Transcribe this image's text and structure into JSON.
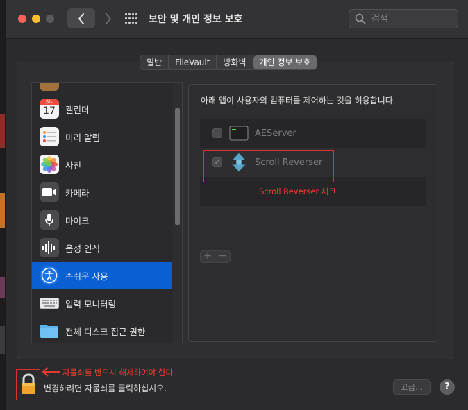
{
  "window": {
    "title": "보안 및 개인 정보 보호",
    "search_placeholder": "검색"
  },
  "tabs": [
    {
      "label": "일반",
      "active": false
    },
    {
      "label": "FileVault",
      "active": false
    },
    {
      "label": "방화벽",
      "active": false
    },
    {
      "label": "개인 정보 보호",
      "active": true
    }
  ],
  "sidebar": {
    "items": [
      {
        "label": "캘린더",
        "icon": "calendar-icon",
        "calendar_month": "JUL",
        "calendar_day": "17"
      },
      {
        "label": "미리 알림",
        "icon": "reminders-icon"
      },
      {
        "label": "사진",
        "icon": "photos-icon"
      },
      {
        "label": "카메라",
        "icon": "camera-icon"
      },
      {
        "label": "마이크",
        "icon": "microphone-icon"
      },
      {
        "label": "음성 인식",
        "icon": "speech-recognition-icon"
      },
      {
        "label": "손쉬운 사용",
        "icon": "accessibility-icon",
        "selected": true
      },
      {
        "label": "입력 모니터링",
        "icon": "keyboard-icon"
      },
      {
        "label": "전체 디스크 접근 권한",
        "icon": "folder-icon"
      }
    ]
  },
  "right_panel": {
    "description": "아래 앱이 사용자의 컴퓨터를 제어하는 것을 허용합니다.",
    "apps": [
      {
        "name": "AEServer",
        "checked": false,
        "icon": "terminal-icon"
      },
      {
        "name": "Scroll Reverser",
        "checked": true,
        "icon": "scroll-reverser-icon"
      }
    ],
    "add_label": "+",
    "remove_label": "−"
  },
  "annotations": {
    "scroll_note": "Scroll Reverser 체크",
    "lock_note": "자물쇠를 반드시 해제하여야 한다.",
    "color": "#ff3b30"
  },
  "footer": {
    "lock_text": "변경하려면 자물쇠를 클릭하십시오.",
    "advanced_label": "고급...",
    "help_label": "?"
  }
}
